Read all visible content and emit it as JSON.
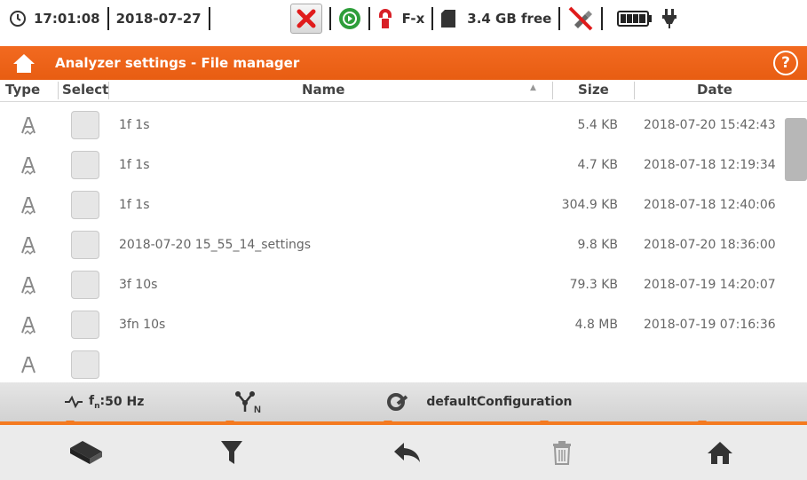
{
  "status": {
    "time": "17:01:08",
    "date": "2018-07-27",
    "clamp_label": "F-x",
    "storage_free": "3.4 GB free",
    "icons": [
      "clock-icon",
      "error-x-icon",
      "record-play-icon",
      "clamp-icon",
      "sd-card-icon",
      "usb-disconnected-icon",
      "battery-icon",
      "plug-icon"
    ]
  },
  "title": "Analyzer settings - File manager",
  "columns": {
    "type": "Type",
    "select": "Select",
    "name": "Name",
    "size": "Size",
    "date": "Date"
  },
  "files": [
    {
      "name": "1f 1s",
      "size": "5.4 KB",
      "date": "2018-07-20 15:42:43"
    },
    {
      "name": "1f 1s",
      "size": "4.7 KB",
      "date": "2018-07-18 12:19:34"
    },
    {
      "name": "1f 1s",
      "size": "304.9 KB",
      "date": "2018-07-18 12:40:06"
    },
    {
      "name": "2018-07-20 15_55_14_settings",
      "size": "9.8 KB",
      "date": "2018-07-20 18:36:00"
    },
    {
      "name": "3f 10s",
      "size": "79.3 KB",
      "date": "2018-07-19 14:20:07"
    },
    {
      "name": "3fn 10s",
      "size": "4.8 MB",
      "date": "2018-07-19 07:16:36"
    }
  ],
  "info": {
    "frequency": "50 Hz",
    "configuration": "defaultConfiguration"
  },
  "colors": {
    "accent": "#f26a20",
    "error_red": "#e01b1b",
    "record_green": "#2e9e3a"
  }
}
